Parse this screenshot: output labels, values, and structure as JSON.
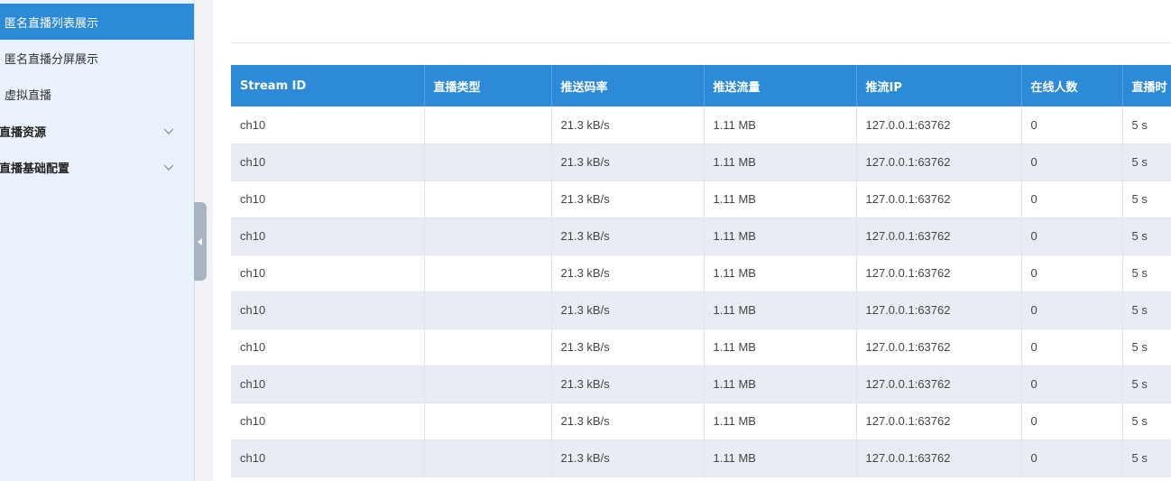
{
  "sidebar": {
    "items": [
      {
        "label": "匿名直播列表展示",
        "active": true
      },
      {
        "label": "匿名直播分屏展示"
      },
      {
        "label": "虚拟直播"
      }
    ],
    "groups": [
      {
        "label": "直播资源",
        "icon": "chevron-down-icon"
      },
      {
        "label": "直播基础配置",
        "icon": "chevron-down-icon"
      }
    ]
  },
  "collapse_handle": {
    "icon": "caret-left-icon"
  },
  "table": {
    "headers": [
      "Stream ID",
      "直播类型",
      "推送码率",
      "推送流量",
      "推流IP",
      "在线人数",
      "直播时"
    ],
    "rows": [
      [
        "ch10",
        "",
        "21.3 kB/s",
        "1.11 MB",
        "127.0.0.1:63762",
        "0",
        "5 s"
      ],
      [
        "ch10",
        "",
        "21.3 kB/s",
        "1.11 MB",
        "127.0.0.1:63762",
        "0",
        "5 s"
      ],
      [
        "ch10",
        "",
        "21.3 kB/s",
        "1.11 MB",
        "127.0.0.1:63762",
        "0",
        "5 s"
      ],
      [
        "ch10",
        "",
        "21.3 kB/s",
        "1.11 MB",
        "127.0.0.1:63762",
        "0",
        "5 s"
      ],
      [
        "ch10",
        "",
        "21.3 kB/s",
        "1.11 MB",
        "127.0.0.1:63762",
        "0",
        "5 s"
      ],
      [
        "ch10",
        "",
        "21.3 kB/s",
        "1.11 MB",
        "127.0.0.1:63762",
        "0",
        "5 s"
      ],
      [
        "ch10",
        "",
        "21.3 kB/s",
        "1.11 MB",
        "127.0.0.1:63762",
        "0",
        "5 s"
      ],
      [
        "ch10",
        "",
        "21.3 kB/s",
        "1.11 MB",
        "127.0.0.1:63762",
        "0",
        "5 s"
      ],
      [
        "ch10",
        "",
        "21.3 kB/s",
        "1.11 MB",
        "127.0.0.1:63762",
        "0",
        "5 s"
      ],
      [
        "ch10",
        "",
        "21.3 kB/s",
        "1.11 MB",
        "127.0.0.1:63762",
        "0",
        "5 s"
      ]
    ]
  },
  "colors": {
    "accent": "#2d8ad8",
    "sidebar_bg": "#eaf2fb",
    "row_alt": "#e9edf3"
  }
}
